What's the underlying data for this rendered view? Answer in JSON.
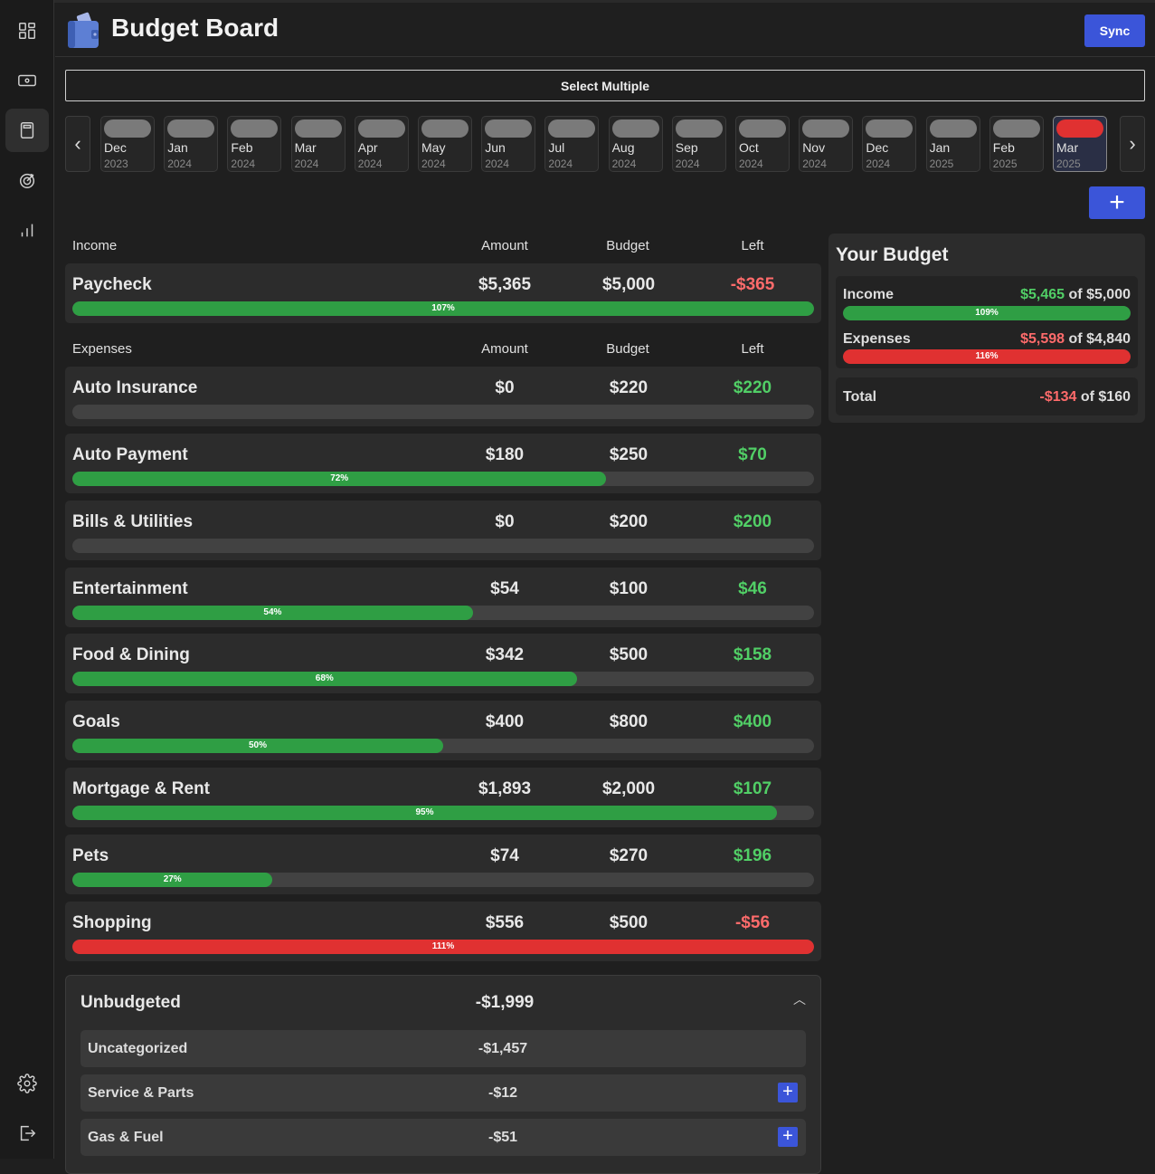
{
  "app": {
    "title": "Budget Board",
    "sync_label": "Sync"
  },
  "sidebar": {
    "items": [
      "dashboard",
      "accounts",
      "budgets",
      "goals",
      "trends"
    ],
    "bottom": [
      "settings",
      "logout"
    ]
  },
  "months": {
    "select_multiple_label": "Select Multiple",
    "items": [
      {
        "month": "Dec",
        "year": "2023"
      },
      {
        "month": "Jan",
        "year": "2024"
      },
      {
        "month": "Feb",
        "year": "2024"
      },
      {
        "month": "Mar",
        "year": "2024"
      },
      {
        "month": "Apr",
        "year": "2024"
      },
      {
        "month": "May",
        "year": "2024"
      },
      {
        "month": "Jun",
        "year": "2024"
      },
      {
        "month": "Jul",
        "year": "2024"
      },
      {
        "month": "Aug",
        "year": "2024"
      },
      {
        "month": "Sep",
        "year": "2024"
      },
      {
        "month": "Oct",
        "year": "2024"
      },
      {
        "month": "Nov",
        "year": "2024"
      },
      {
        "month": "Dec",
        "year": "2024"
      },
      {
        "month": "Jan",
        "year": "2025"
      },
      {
        "month": "Feb",
        "year": "2025"
      },
      {
        "month": "Mar",
        "year": "2025",
        "selected": true
      }
    ]
  },
  "add_label": "+",
  "income": {
    "header": {
      "label": "Income",
      "amount": "Amount",
      "budget": "Budget",
      "left": "Left"
    },
    "rows": [
      {
        "name": "Paycheck",
        "amount": "$5,365",
        "budget": "$5,000",
        "left": "-$365",
        "left_color": "neg",
        "progress": 1.07,
        "pct": "107%",
        "bar_color": "green"
      }
    ]
  },
  "expenses": {
    "header": {
      "label": "Expenses",
      "amount": "Amount",
      "budget": "Budget",
      "left": "Left"
    },
    "rows": [
      {
        "name": "Auto Insurance",
        "amount": "$0",
        "budget": "$220",
        "left": "$220",
        "left_color": "pos",
        "progress": 0,
        "pct": "",
        "bar_color": "green"
      },
      {
        "name": "Auto Payment",
        "amount": "$180",
        "budget": "$250",
        "left": "$70",
        "left_color": "pos",
        "progress": 0.72,
        "pct": "72%",
        "bar_color": "green"
      },
      {
        "name": "Bills & Utilities",
        "amount": "$0",
        "budget": "$200",
        "left": "$200",
        "left_color": "pos",
        "progress": 0,
        "pct": "",
        "bar_color": "green"
      },
      {
        "name": "Entertainment",
        "amount": "$54",
        "budget": "$100",
        "left": "$46",
        "left_color": "pos",
        "progress": 0.54,
        "pct": "54%",
        "bar_color": "green"
      },
      {
        "name": "Food & Dining",
        "amount": "$342",
        "budget": "$500",
        "left": "$158",
        "left_color": "pos",
        "progress": 0.68,
        "pct": "68%",
        "bar_color": "green"
      },
      {
        "name": "Goals",
        "amount": "$400",
        "budget": "$800",
        "left": "$400",
        "left_color": "pos",
        "progress": 0.5,
        "pct": "50%",
        "bar_color": "green"
      },
      {
        "name": "Mortgage & Rent",
        "amount": "$1,893",
        "budget": "$2,000",
        "left": "$107",
        "left_color": "pos",
        "progress": 0.95,
        "pct": "95%",
        "bar_color": "green"
      },
      {
        "name": "Pets",
        "amount": "$74",
        "budget": "$270",
        "left": "$196",
        "left_color": "pos",
        "progress": 0.27,
        "pct": "27%",
        "bar_color": "green"
      },
      {
        "name": "Shopping",
        "amount": "$556",
        "budget": "$500",
        "left": "-$56",
        "left_color": "neg",
        "progress": 1.11,
        "pct": "111%",
        "bar_color": "red"
      }
    ]
  },
  "unbudgeted": {
    "title": "Unbudgeted",
    "total": "-$1,999",
    "items": [
      {
        "name": "Uncategorized",
        "amount": "-$1,457",
        "addable": false
      },
      {
        "name": "Service & Parts",
        "amount": "-$12",
        "addable": true
      },
      {
        "name": "Gas & Fuel",
        "amount": "-$51",
        "addable": true
      }
    ]
  },
  "summary": {
    "title": "Your Budget",
    "income": {
      "label": "Income",
      "amount": "$5,465",
      "of": "of $5,000",
      "progress": 1.09,
      "pct": "109%"
    },
    "expenses": {
      "label": "Expenses",
      "amount": "$5,598",
      "of": "of $4,840",
      "progress": 1.16,
      "pct": "116%"
    },
    "total": {
      "label": "Total",
      "amount": "-$134",
      "of": "of $160"
    }
  },
  "colors": {
    "accent": "#3b55d9",
    "green": "#2f9e44",
    "red": "#e03131",
    "pos_text": "#51cf66",
    "neg_text": "#ff6b6b"
  }
}
